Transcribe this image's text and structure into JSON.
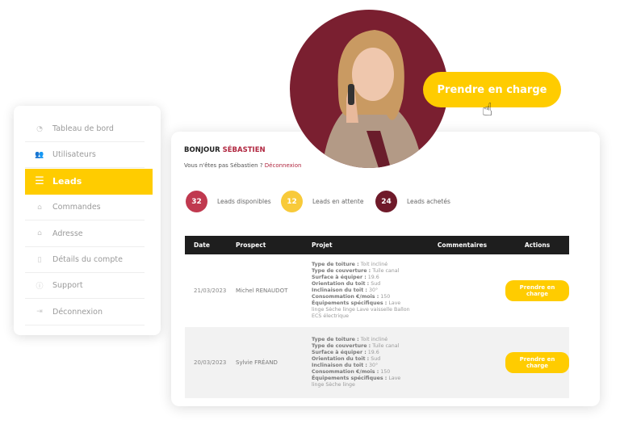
{
  "colors": {
    "accent": "#ffcc00",
    "brand": "#b0263f",
    "maroon": "#7a1f30"
  },
  "cta": {
    "label": "Prendre en charge",
    "icon": "hand-pointer-icon"
  },
  "sidebar": {
    "items": [
      {
        "label": "Tableau de bord",
        "icon": "dashboard-icon"
      },
      {
        "label": "Utilisateurs",
        "icon": "users-icon"
      },
      {
        "label": "Leads",
        "icon": "list-icon",
        "active": true
      },
      {
        "label": "Commandes",
        "icon": "basket-icon"
      },
      {
        "label": "Adresse",
        "icon": "home-icon"
      },
      {
        "label": "Détails du compte",
        "icon": "document-icon"
      },
      {
        "label": "Support",
        "icon": "info-icon"
      },
      {
        "label": "Déconnexion",
        "icon": "logout-icon"
      }
    ]
  },
  "greeting": {
    "prefix": "BONJOUR",
    "name": "SÉBASTIEN",
    "sub": "Vous n'êtes pas Sébastien ?",
    "logout": "Déconnexion"
  },
  "stats": [
    {
      "value": "32",
      "label": "Leads disponibles",
      "color": "#c0394f"
    },
    {
      "value": "12",
      "label": "Leads en attente",
      "color": "#f8ca3a"
    },
    {
      "value": "24",
      "label": "Leads achetés",
      "color": "#6f1a2a"
    }
  ],
  "table": {
    "headers": [
      "Date",
      "Prospect",
      "Projet",
      "Commentaires",
      "Actions"
    ],
    "rows": [
      {
        "date": "21/03/2023",
        "prospect": "Michel RENAUDOT",
        "projet": [
          [
            "Type de toiture :",
            "Toit incliné"
          ],
          [
            "Type de couverture :",
            "Tuile canal"
          ],
          [
            "Surface à équiper :",
            "19.6"
          ],
          [
            "Orientation du toit :",
            "Sud"
          ],
          [
            "Inclinaison du toit :",
            "30°"
          ],
          [
            "Consommation €/mois :",
            "150"
          ],
          [
            "Équipements spécifiques :",
            "Lave linge Sèche linge Lave vaisselle Ballon ECS électrique"
          ]
        ],
        "comment": "",
        "action": "Prendre en charge"
      },
      {
        "date": "20/03/2023",
        "prospect": "Sylvie FRÉAND",
        "projet": [
          [
            "Type de toiture :",
            "Toit incliné"
          ],
          [
            "Type de couverture :",
            "Tuile canal"
          ],
          [
            "Surface à équiper :",
            "19.6"
          ],
          [
            "Orientation du toit :",
            "Sud"
          ],
          [
            "Inclinaison du toit :",
            "30°"
          ],
          [
            "Consommation €/mois :",
            "150"
          ],
          [
            "Équipements spécifiques :",
            "Lave linge Sèche linge"
          ]
        ],
        "comment": "",
        "action": "Prendre en charge"
      }
    ]
  }
}
